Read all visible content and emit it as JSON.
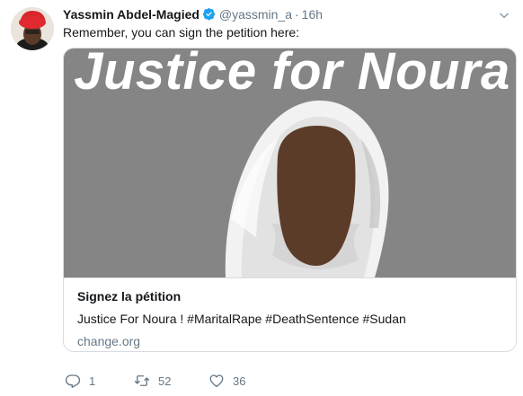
{
  "tweet": {
    "author": {
      "display_name": "Yassmin Abdel-Magied",
      "handle": "@yassmin_a"
    },
    "separator": "·",
    "timestamp": "16h",
    "text": "Remember, you can sign the petition here:"
  },
  "card": {
    "image_title": "Justice for Noura",
    "title": "Signez la pétition",
    "description": "Justice For Noura ! #MaritalRape #DeathSentence #Sudan",
    "domain": "change.org"
  },
  "actions": {
    "reply_count": "1",
    "retweet_count": "52",
    "like_count": "36"
  },
  "colors": {
    "card_image_background": "#858585",
    "verified": "#1da1f2",
    "secondary_text": "#657786",
    "border": "#d7dde2"
  },
  "icons": [
    "verified-badge-icon",
    "chevron-down-icon",
    "reply-icon",
    "retweet-icon",
    "like-icon"
  ]
}
